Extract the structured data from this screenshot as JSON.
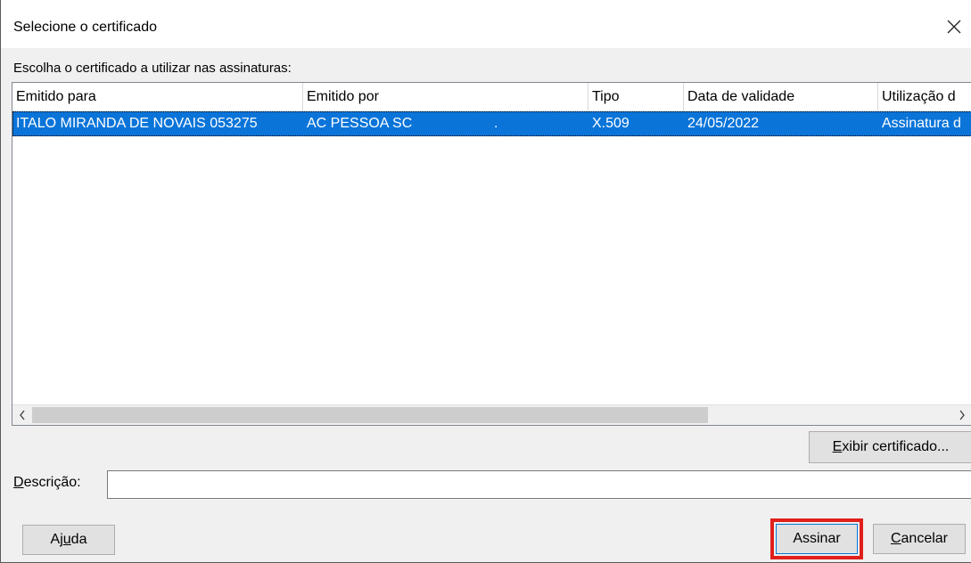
{
  "window": {
    "title": "Selecione o certificado",
    "close_icon": "close-icon"
  },
  "list": {
    "caption": "Escolha o certificado a utilizar nas assinaturas:",
    "columns": [
      "Emitido para",
      "Emitido por",
      "Tipo",
      "Data de validade",
      "Utilização d"
    ],
    "rows": [
      {
        "emitido_para": "ITALO MIRANDA DE NOVAIS 053275",
        "emitido_por": "AC PESSOA SC",
        "separator": ".",
        "tipo": "X.509",
        "data_validade": "24/05/2022",
        "utilizacao": "Assinatura d",
        "selected": true
      }
    ],
    "scroll_left_icon": "chevron-left-icon",
    "scroll_right_icon": "chevron-right-icon"
  },
  "buttons": {
    "view_certificate": {
      "accel": "E",
      "rest": "xibir certificado..."
    },
    "help": {
      "pre": "Aj",
      "accel": "u",
      "post": "da"
    },
    "sign": "Assinar",
    "cancel": {
      "accel": "C",
      "rest": "ancelar"
    }
  },
  "description": {
    "label_accel": "D",
    "label_rest": "escrição:",
    "value": "",
    "placeholder": ""
  },
  "colors": {
    "selection": "#0a74d9",
    "highlight_box": "#e0201b"
  }
}
